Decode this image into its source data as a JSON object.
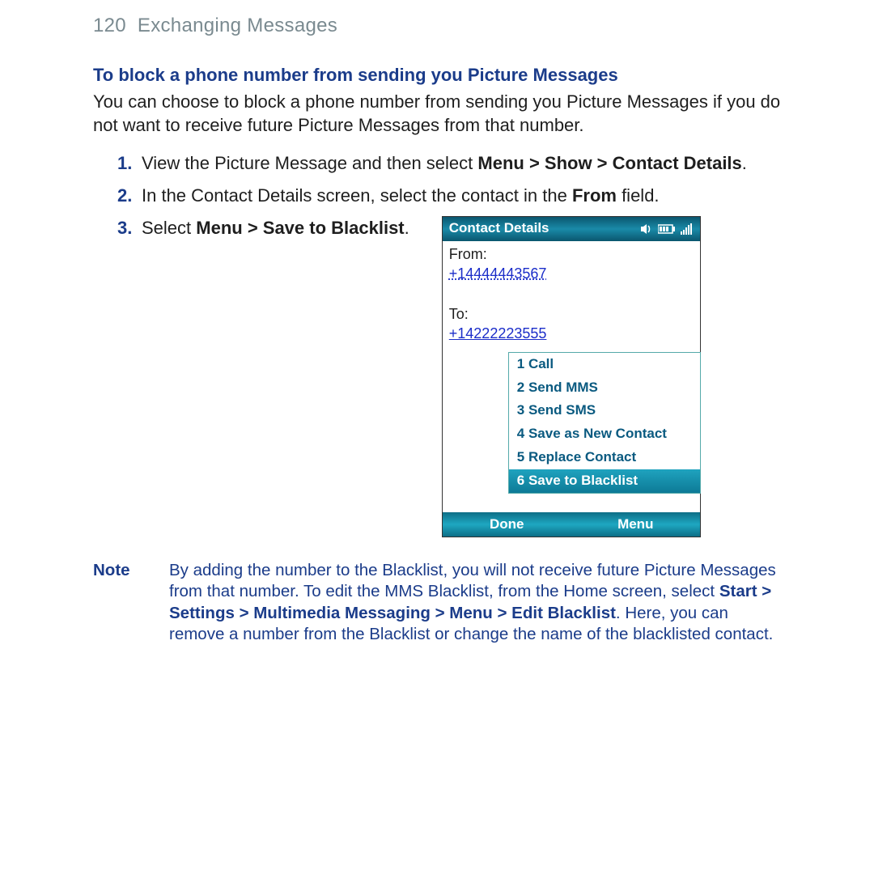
{
  "header": {
    "page_number": "120",
    "chapter": "Exchanging Messages"
  },
  "section_title": "To block a phone number from sending you Picture Messages",
  "intro": "You can choose to block a phone number from sending you Picture Messages if you do not want to receive future Picture Messages from that number.",
  "steps": {
    "1": {
      "num": "1.",
      "pre": "View the Picture Message and then select ",
      "bold": "Menu > Show > Contact Details",
      "post": "."
    },
    "2": {
      "num": "2.",
      "pre": "In the Contact Details screen, select the contact in the ",
      "bold": "From",
      "post": " field."
    },
    "3": {
      "num": "3.",
      "pre": "Select ",
      "bold": "Menu > Save to Blacklist",
      "post": "."
    }
  },
  "phone": {
    "title": "Contact Details",
    "from_label": "From:",
    "from_number": "+14444443567",
    "to_label": "To:",
    "to_number": "+14222223555",
    "menu": {
      "1": "1 Call",
      "2": "2 Send MMS",
      "3": "3 Send SMS",
      "4": "4 Save as New Contact",
      "5": "5 Replace Contact",
      "6": "6 Save to Blacklist"
    },
    "soft_left": "Done",
    "soft_right": "Menu"
  },
  "note": {
    "label": "Note",
    "t1": "By adding the number to the Blacklist, you will not receive future Picture Messages from that number. To edit the MMS Blacklist, from the Home screen, select ",
    "b1": "Start > Settings > Multimedia Messaging > Menu > Edit Blacklist",
    "t2": ". Here, you can remove a number from the Blacklist or change the name of the blacklisted contact."
  }
}
